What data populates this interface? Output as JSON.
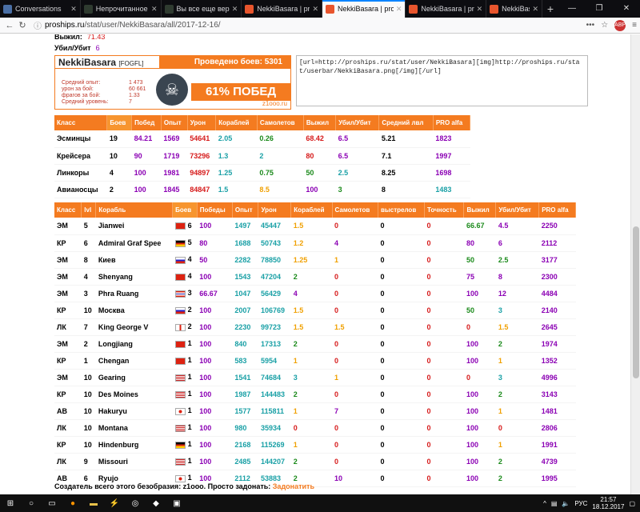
{
  "browser": {
    "tabs": [
      {
        "title": "Conversations",
        "color": "#4a6fa5"
      },
      {
        "title": "Непрочитанное - Офи",
        "color": "#2f3b30"
      },
      {
        "title": "Вы все еще верите в",
        "color": "#2f3b30"
      },
      {
        "title": "NekkiBasara | proship",
        "color": "#e8552d"
      },
      {
        "title": "NekkiBasara | proship",
        "color": "#e8552d",
        "active": true
      },
      {
        "title": "NekkiBasara | proship",
        "color": "#e8552d"
      },
      {
        "title": "NekkiBasara | proship",
        "color": "#e8552d"
      }
    ],
    "url_host": "proships.ru",
    "url_path": "/stat/user/NekkiBasara/all/2017-12-16/",
    "win": [
      "—",
      "❐",
      "✕"
    ]
  },
  "summary": {
    "prev_label": "Выжил:",
    "prev_value": "71.43",
    "label": "Убил/Убит",
    "value": "6"
  },
  "banner": {
    "name": "NekkiBasara",
    "clan": "[FOGFL]",
    "battles": "Проведено боев: 5301",
    "stats": [
      {
        "label": "Средний опыт:",
        "value": "1 473"
      },
      {
        "label": "урон за бой:",
        "value": "60 661"
      },
      {
        "label": "фрагов за бой:",
        "value": "1.33"
      },
      {
        "label": "Средний уровень:",
        "value": "7"
      }
    ],
    "wins": "61% ПОБЕД",
    "logo": "z1ooo.ru"
  },
  "code": "[url=http://proships.ru/stat/user/NekkiBasara][img]http://proships.ru/stat/userbar/NekkiBasara.png[/img][/url]",
  "classTable": {
    "headers": [
      "Класс",
      "Боев",
      "Побед",
      "Опыт",
      "Урон",
      "Кораблей",
      "Самолетов",
      "Выжил",
      "Убил/Убит",
      "Средний лвл",
      "PRO alfa"
    ],
    "rows": [
      [
        "Эсминцы",
        "19",
        "84.21",
        "1569",
        "54641",
        "2.05",
        "0.26",
        "68.42",
        "6.5",
        "5.21",
        "1823"
      ],
      [
        "Крейсера",
        "10",
        "90",
        "1719",
        "73296",
        "1.3",
        "2",
        "80",
        "6.5",
        "7.1",
        "1997"
      ],
      [
        "Линкоры",
        "4",
        "100",
        "1981",
        "94897",
        "1.25",
        "0.75",
        "50",
        "2.5",
        "8.25",
        "1698"
      ],
      [
        "Авианосцы",
        "2",
        "100",
        "1845",
        "84847",
        "1.5",
        "8.5",
        "100",
        "3",
        "8",
        "1483"
      ]
    ],
    "colors": [
      [
        "b",
        "b",
        "p",
        "p",
        "r",
        "t",
        "g",
        "r",
        "p",
        "b",
        "p"
      ],
      [
        "b",
        "b",
        "p",
        "p",
        "r",
        "t",
        "t",
        "r",
        "p",
        "b",
        "p"
      ],
      [
        "b",
        "b",
        "p",
        "p",
        "r",
        "t",
        "g",
        "g",
        "t",
        "b",
        "p"
      ],
      [
        "b",
        "b",
        "p",
        "p",
        "r",
        "t",
        "o",
        "p",
        "g",
        "b",
        "t"
      ]
    ]
  },
  "shipTable": {
    "headers": [
      "Класс",
      "lvl",
      "Корабль",
      "Боев",
      "Победы",
      "Опыт",
      "Урон",
      "Кораблей",
      "Самолетов",
      "выстрелов",
      "Точность",
      "Выжил",
      "Убил/Убит",
      "PRO alfa"
    ],
    "rows": [
      [
        "ЭМ",
        "5",
        "Jianwei",
        "cn",
        "6",
        "100",
        "1497",
        "45447",
        "1.5",
        "0",
        "0",
        "0",
        "66.67",
        "4.5",
        "2250"
      ],
      [
        "КР",
        "6",
        "Admiral Graf Spee",
        "de",
        "5",
        "80",
        "1688",
        "50743",
        "1.2",
        "4",
        "0",
        "0",
        "80",
        "6",
        "2112"
      ],
      [
        "ЭМ",
        "8",
        "Киев",
        "ru",
        "4",
        "50",
        "2282",
        "78850",
        "1.25",
        "1",
        "0",
        "0",
        "50",
        "2.5",
        "3177"
      ],
      [
        "ЭМ",
        "4",
        "Shenyang",
        "cn",
        "4",
        "100",
        "1543",
        "47204",
        "2",
        "0",
        "0",
        "0",
        "75",
        "8",
        "2300"
      ],
      [
        "ЭМ",
        "3",
        "Phra Ruang",
        "th",
        "3",
        "66.67",
        "1047",
        "56429",
        "4",
        "0",
        "0",
        "0",
        "100",
        "12",
        "4484"
      ],
      [
        "КР",
        "10",
        "Москва",
        "ru",
        "2",
        "100",
        "2007",
        "106769",
        "1.5",
        "0",
        "0",
        "0",
        "50",
        "3",
        "2140"
      ],
      [
        "ЛК",
        "7",
        "King George V",
        "uk",
        "2",
        "100",
        "2230",
        "99723",
        "1.5",
        "1.5",
        "0",
        "0",
        "0",
        "1.5",
        "2645"
      ],
      [
        "ЭМ",
        "2",
        "Longjiang",
        "cn",
        "1",
        "100",
        "840",
        "17313",
        "2",
        "0",
        "0",
        "0",
        "100",
        "2",
        "1974"
      ],
      [
        "КР",
        "1",
        "Chengan",
        "cn",
        "1",
        "100",
        "583",
        "5954",
        "1",
        "0",
        "0",
        "0",
        "100",
        "1",
        "1352"
      ],
      [
        "ЭМ",
        "10",
        "Gearing",
        "us",
        "1",
        "100",
        "1541",
        "74684",
        "3",
        "1",
        "0",
        "0",
        "0",
        "3",
        "4996"
      ],
      [
        "КР",
        "10",
        "Des Moines",
        "us",
        "1",
        "100",
        "1987",
        "144483",
        "2",
        "0",
        "0",
        "0",
        "100",
        "2",
        "3143"
      ],
      [
        "АВ",
        "10",
        "Hakuryu",
        "jp",
        "1",
        "100",
        "1577",
        "115811",
        "1",
        "7",
        "0",
        "0",
        "100",
        "1",
        "1481"
      ],
      [
        "ЛК",
        "10",
        "Montana",
        "us",
        "1",
        "100",
        "980",
        "35934",
        "0",
        "0",
        "0",
        "0",
        "100",
        "0",
        "2806"
      ],
      [
        "КР",
        "10",
        "Hindenburg",
        "de",
        "1",
        "100",
        "2168",
        "115269",
        "1",
        "0",
        "0",
        "0",
        "100",
        "1",
        "1991"
      ],
      [
        "ЛК",
        "9",
        "Missouri",
        "us",
        "1",
        "100",
        "2485",
        "144207",
        "2",
        "0",
        "0",
        "0",
        "100",
        "2",
        "4739"
      ],
      [
        "АВ",
        "6",
        "Ryujo",
        "jp",
        "1",
        "100",
        "2112",
        "53883",
        "2",
        "10",
        "0",
        "0",
        "100",
        "2",
        "1995"
      ]
    ]
  },
  "footer": {
    "text": "Создатель всего этого безобразия: z1ooo. Просто задонать:",
    "link": "Задонатить"
  },
  "taskbar": {
    "lang": "РУС",
    "time": "21:57",
    "date": "18.12.2017"
  }
}
